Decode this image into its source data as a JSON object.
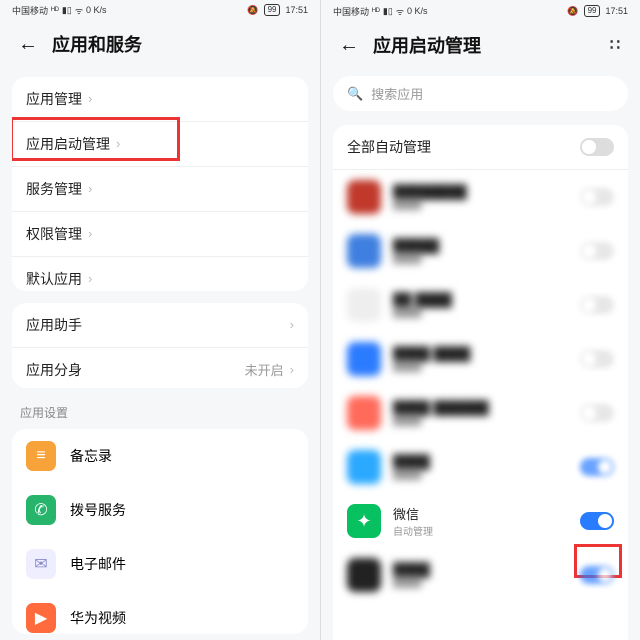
{
  "status": {
    "carrier": "中国移动",
    "net_small": "⁴⁶",
    "wifi": "⌔",
    "speed": "0 K/s",
    "battery": "99",
    "time": "17:51",
    "silent": "🔇"
  },
  "left": {
    "title": "应用和服务",
    "group1": [
      "应用管理",
      "应用启动管理",
      "服务管理",
      "权限管理",
      "默认应用"
    ],
    "group2": [
      {
        "label": "应用助手",
        "value": ""
      },
      {
        "label": "应用分身",
        "value": "未开启"
      }
    ],
    "section_settings": "应用设置",
    "settings": [
      {
        "label": "备忘录",
        "color": "#f8a23a"
      },
      {
        "label": "拨号服务",
        "color": "#27b56b"
      },
      {
        "label": "电子邮件",
        "color": "#e8e8f5"
      },
      {
        "label": "华为视频",
        "color": "#ff6b3d"
      }
    ]
  },
  "right": {
    "title": "应用启动管理",
    "search_placeholder": "搜索应用",
    "all_auto": "全部自动管理",
    "wechat": {
      "name": "微信",
      "sub": "自动管理",
      "icon": "#07c160"
    }
  }
}
